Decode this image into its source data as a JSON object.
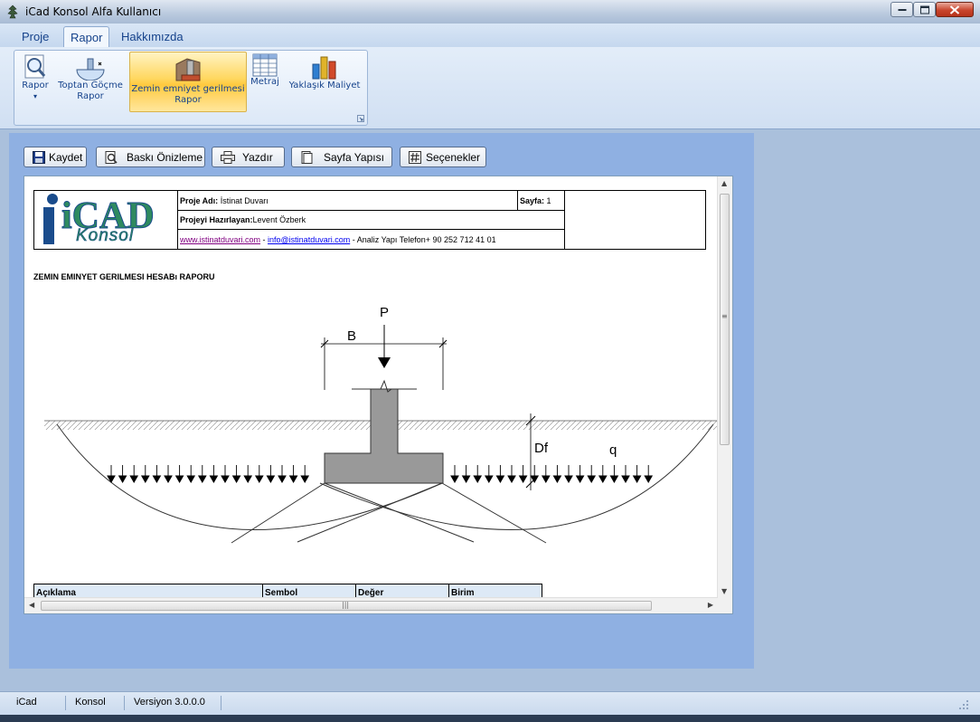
{
  "window": {
    "title": "iCad Konsol Alfa Kullanıcı"
  },
  "ribbon": {
    "tabs": [
      {
        "label": "Proje"
      },
      {
        "label": "Rapor"
      },
      {
        "label": "Hakkımızda"
      }
    ],
    "buttons": [
      {
        "label1": "Rapor",
        "label2": "▾"
      },
      {
        "label1": "Toptan Göçme",
        "label2": "Rapor"
      },
      {
        "label1": "Zemin emniyet gerilmesi",
        "label2": "Rapor"
      },
      {
        "label1": "Metraj"
      },
      {
        "label1": "Yaklaşık Maliyet"
      }
    ]
  },
  "toolbar": {
    "save": "Kaydet",
    "preview": "Baskı Önizleme",
    "print": "Yazdır",
    "page_setup": "Sayfa Yapısı",
    "options": "Seçenekler"
  },
  "report": {
    "logo_text_main": "iCAD",
    "logo_text_sub": "Konsol",
    "project_label": "Proje Adı:",
    "project_value": "İstinat Duvarı",
    "page_label": "Sayfa:",
    "page_value": "1",
    "author_label": "Projeyi Hazırlayan:",
    "author_value": "Levent Özberk",
    "website": "www.istinatduvari.com",
    "separator": " - ",
    "email": "info@istinatduvari.com",
    "contact": " - Analiz Yapı Telefon+ 90 252 712 41 01",
    "title": "ZEMIN EMINYET GERILMESI HESABı RAPORU",
    "diagram_labels": {
      "p": "P",
      "b": "B",
      "df": "Df",
      "q": "q"
    },
    "table_headers": [
      "Açıklama",
      "Sembol",
      "Değer",
      "Birim"
    ]
  },
  "statusbar": {
    "app": "iCad",
    "module": "Konsol",
    "version": "Versiyon 3.0.0.0"
  },
  "colors": {
    "ribbon_text": "#15428b",
    "active_button": "#ffd75e",
    "content_bg": "#8fb0e2",
    "logo_blue": "#1a4c8c",
    "logo_green": "#2e8a5f"
  }
}
